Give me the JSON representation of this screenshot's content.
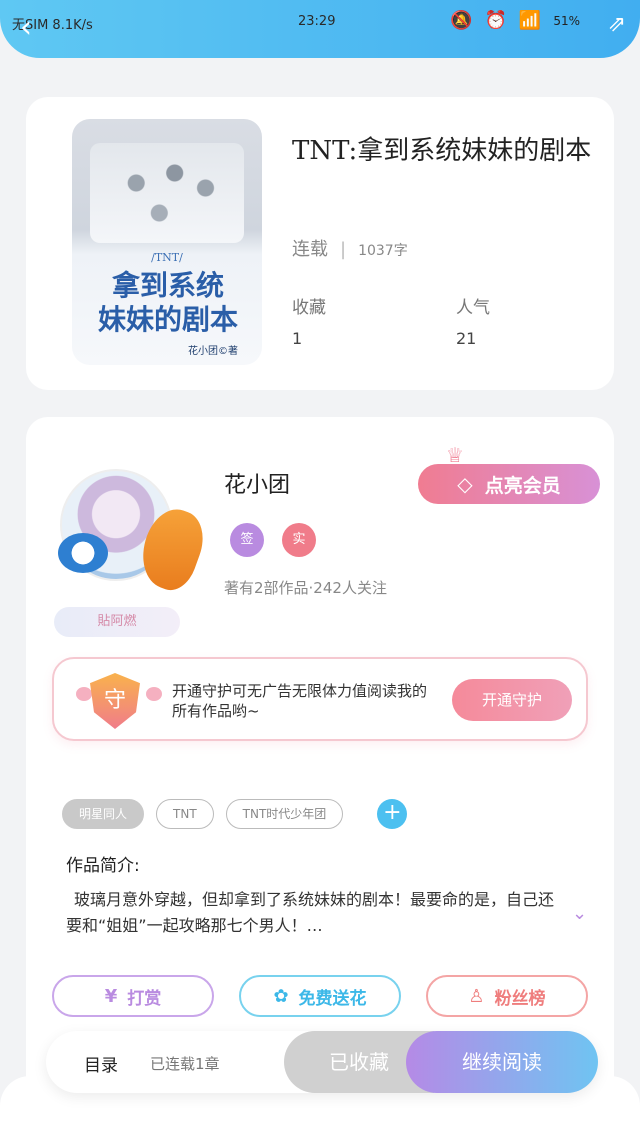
{
  "status": {
    "left_text": "无SIM 8.1K/s",
    "time": "23:29",
    "battery": "51%",
    "icons": [
      "mute-icon",
      "alarm-icon",
      "wifi-icon",
      "battery-icon"
    ]
  },
  "nav": {
    "back_icon": "chevron-left-icon",
    "share_icon": "share-icon"
  },
  "book": {
    "cover": {
      "small_tag": "/TNT/",
      "title_line1": "拿到系统",
      "title_line2": "妹妹的剧本",
      "author_mark": "花小团©著"
    },
    "title": "TNT:拿到系统妹妹的剧本",
    "status": "连载",
    "words": "1037字",
    "collect_label": "收藏",
    "collect_value": "1",
    "popularity_label": "人气",
    "popularity_value": "21"
  },
  "author": {
    "name": "花小团",
    "vip_label": "点亮会员",
    "tag_sign": "签",
    "tag_real": "实",
    "stats": "著有2部作品·242人关注",
    "badge": "貼阿燃"
  },
  "guard": {
    "shield_label": "守",
    "text": "开通守护可无广告无限体力值阅读我的所有作品哟~",
    "button": "开通守护"
  },
  "tags": [
    "明星同人",
    "TNT",
    "TNT时代少年团"
  ],
  "intro": {
    "title": "作品简介:",
    "text": "玻璃月意外穿越，但却拿到了系统妹妹的剧本！最要命的是，自己还要和“姐姐”一起攻略那七个男人！…"
  },
  "actions": {
    "tip": "打赏",
    "flower": "免费送花",
    "fans": "粉丝榜"
  },
  "bottom": {
    "toc": "目录",
    "toc_count": "已连载1章",
    "collected": "已收藏",
    "read": "继续阅读"
  },
  "colors": {
    "header": "#41aef0",
    "vip": "#f07c91",
    "purple": "#b98be0",
    "blue": "#4cc0f0"
  }
}
